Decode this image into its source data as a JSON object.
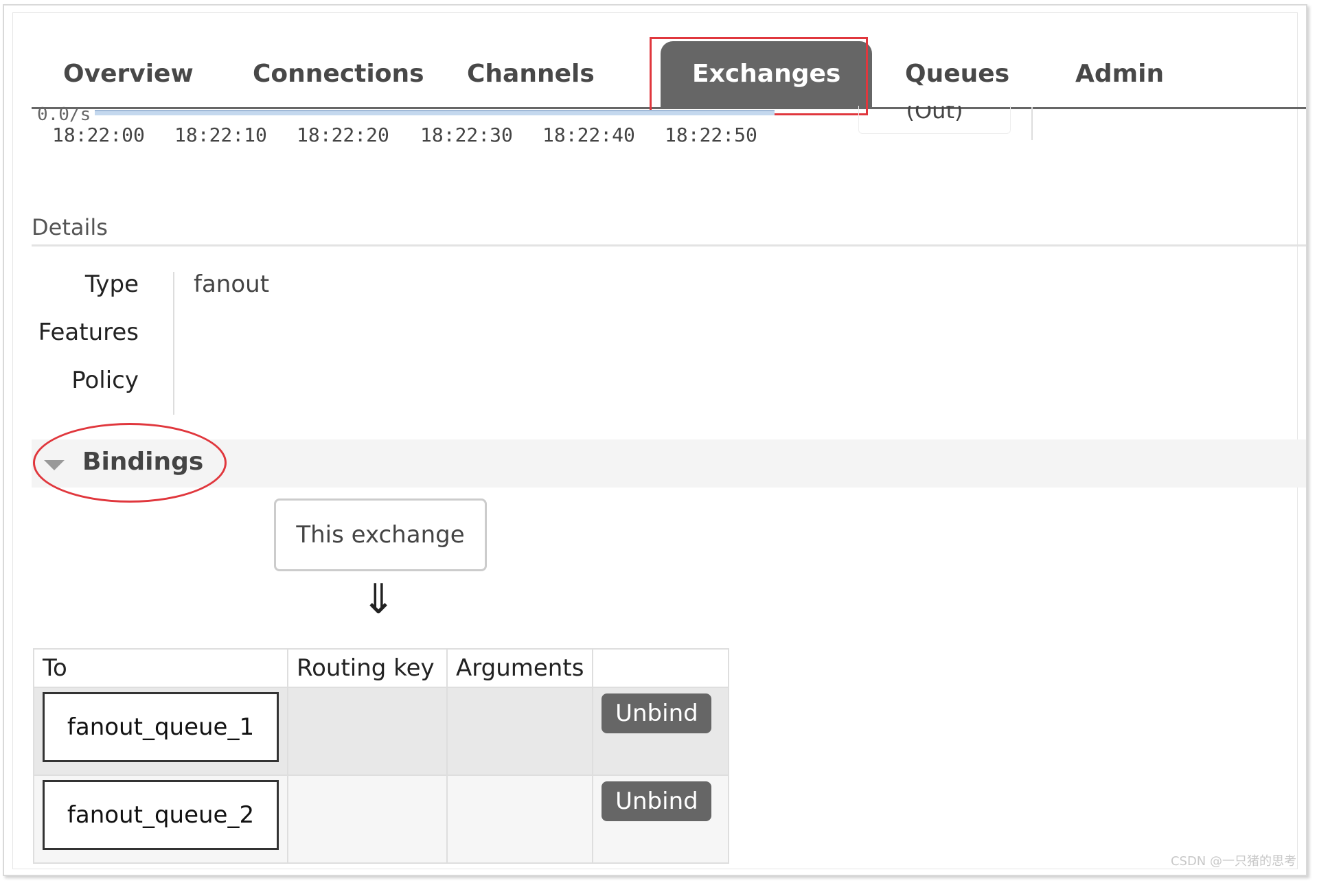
{
  "nav": {
    "tabs": [
      {
        "label": "Overview"
      },
      {
        "label": "Connections"
      },
      {
        "label": "Channels"
      },
      {
        "label": "Exchanges",
        "active": true
      },
      {
        "label": "Queues"
      },
      {
        "label": "Admin"
      }
    ]
  },
  "chart": {
    "rate_label": "0.0/s",
    "times": [
      "18:22:00",
      "18:22:10",
      "18:22:20",
      "18:22:30",
      "18:22:40",
      "18:22:50"
    ],
    "out_label": "(Out)"
  },
  "details": {
    "title": "Details",
    "type_label": "Type",
    "type_value": "fanout",
    "features_label": "Features",
    "policy_label": "Policy"
  },
  "bindings": {
    "title": "Bindings",
    "source_label": "This exchange",
    "arrow": "⇓",
    "columns": {
      "to": "To",
      "routing_key": "Routing key",
      "arguments": "Arguments"
    },
    "rows": [
      {
        "to": "fanout_queue_1",
        "routing_key": "",
        "arguments": "",
        "action": "Unbind"
      },
      {
        "to": "fanout_queue_2",
        "routing_key": "",
        "arguments": "",
        "action": "Unbind"
      }
    ]
  },
  "watermark": "CSDN @一只猪的思考",
  "colors": {
    "tab_active_bg": "#666666",
    "highlight_red": "#e0373d",
    "button_bg": "#666666"
  }
}
